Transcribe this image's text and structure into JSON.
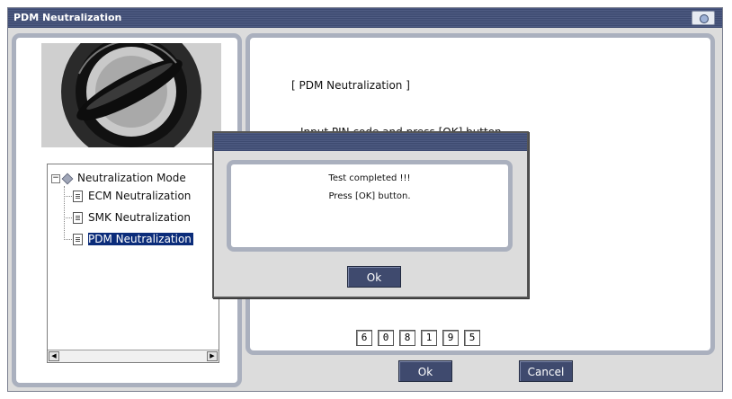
{
  "window": {
    "title": "PDM Neutralization"
  },
  "tree": {
    "root_label": "Neutralization Mode",
    "items": [
      {
        "label": "ECM Neutralization",
        "selected": false
      },
      {
        "label": "SMK Neutralization",
        "selected": false
      },
      {
        "label": "PDM Neutralization",
        "selected": true
      }
    ]
  },
  "content": {
    "heading": "[ PDM Neutralization ]",
    "instruction": "Input PIN code and press [OK] button.",
    "pin_digits": [
      "6",
      "0",
      "8",
      "1",
      "9",
      "5"
    ]
  },
  "buttons": {
    "ok_label": "Ok",
    "cancel_label": "Cancel"
  },
  "dialog": {
    "line1": "Test completed !!!",
    "line2": "Press [OK] button.",
    "ok_label": "Ok"
  },
  "icons": {
    "title_icon": "camera-icon",
    "tree_collapse": "minus-box-icon",
    "root_node": "diamond-icon",
    "leaf_node": "document-icon",
    "scroll_left": "arrow-left-icon",
    "scroll_right": "arrow-right-icon"
  },
  "colors": {
    "title_bar": "#3d4a70",
    "button": "#3f4a6e",
    "selection": "#0b2c7a"
  }
}
